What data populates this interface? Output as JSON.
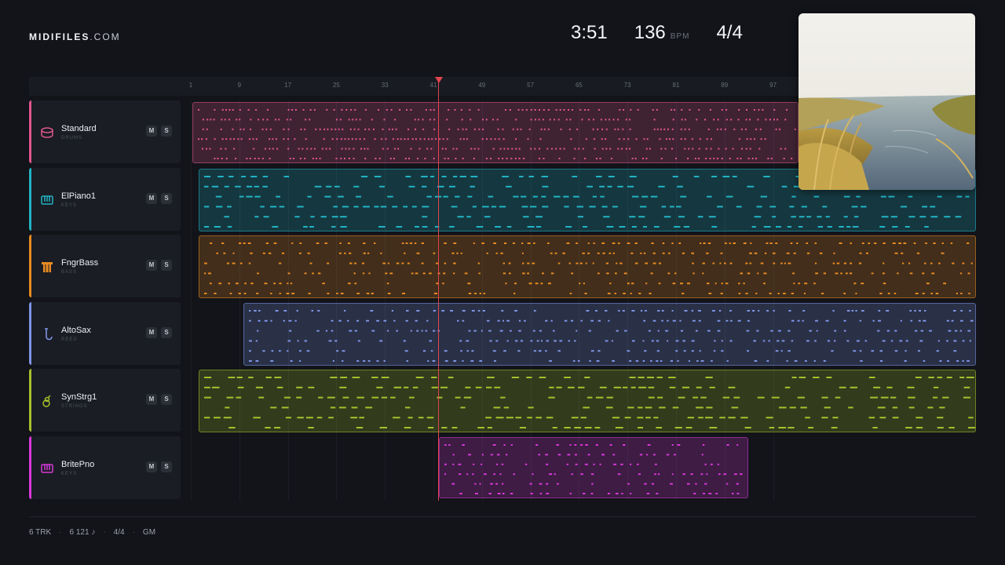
{
  "brand": {
    "bold": "MIDIFILES",
    "light": ".COM"
  },
  "stats": {
    "time": "3:51",
    "bpm": "136",
    "bpm_unit": "BPM",
    "meter": "4/4"
  },
  "ruler": {
    "ticks": [
      "1",
      "9",
      "17",
      "25",
      "33",
      "41",
      "49",
      "57",
      "65",
      "73",
      "81",
      "89",
      "97"
    ]
  },
  "tracks": [
    {
      "name": "Standard",
      "sub": "DRUMS",
      "color": "#e0578b",
      "icon": "drum-icon",
      "mute": "M",
      "solo": "S"
    },
    {
      "name": "ElPiano1",
      "sub": "KEYS",
      "color": "#22b3c4",
      "icon": "piano-icon",
      "mute": "M",
      "solo": "S"
    },
    {
      "name": "FngrBass",
      "sub": "BASS",
      "color": "#e88a22",
      "icon": "bass-icon",
      "mute": "M",
      "solo": "S"
    },
    {
      "name": "AltoSax",
      "sub": "REED",
      "color": "#7f94e6",
      "icon": "sax-icon",
      "mute": "M",
      "solo": "S"
    },
    {
      "name": "SynStrg1",
      "sub": "STRINGS",
      "color": "#a6c02c",
      "icon": "guitar-icon",
      "mute": "M",
      "solo": "S"
    },
    {
      "name": "BritePno",
      "sub": "KEYS",
      "color": "#d838d8",
      "icon": "piano-icon",
      "mute": "M",
      "solo": "S"
    }
  ],
  "footer": {
    "tracks": "6 TRK",
    "notes": "6 121 ♪",
    "meter": "4/4",
    "standard": "GM",
    "sep": "·"
  }
}
